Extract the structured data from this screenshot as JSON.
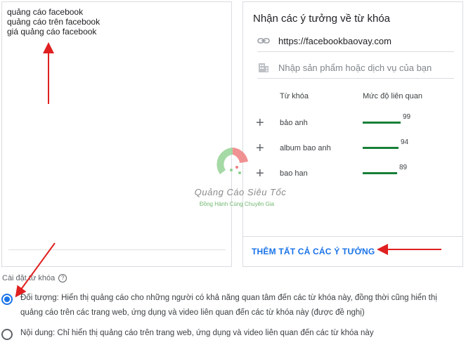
{
  "keywords_box": {
    "text": "quảng cáo facebook\nquảng cáo trên facebook\ngiá quảng cáo facebook"
  },
  "ideas": {
    "title": "Nhận các ý tưởng về từ khóa",
    "url_value": "https://facebookbaovay.com",
    "url_icon": "link-icon",
    "product_placeholder": "Nhập sản phẩm hoặc dịch vụ của bạn",
    "product_icon": "building-icon",
    "col_keyword": "Từ khóa",
    "col_relevance": "Mức độ liên quan",
    "suggestions": [
      {
        "keyword": "bảo anh",
        "relevance": 99,
        "relevance_label": "99"
      },
      {
        "keyword": "album bao anh",
        "relevance": 94,
        "relevance_label": "94"
      },
      {
        "keyword": "bao han",
        "relevance": 89,
        "relevance_label": "89"
      }
    ],
    "add_all_label": "THÊM TẤT CẢ CÁC Ý TƯỞNG",
    "accent_color": "#1a73e8",
    "bar_color": "#188038"
  },
  "settings": {
    "label": "Cài đặt từ khóa",
    "options": [
      {
        "label": "Đối tượng: Hiển thị quảng cáo cho những người có khả năng quan tâm đến các từ khóa này, đồng thời cũng hiển thị quảng cáo trên các trang web, ứng dụng và video liên quan đến các từ khóa này (được đề nghị)",
        "selected": true
      },
      {
        "label": "Nội dung: Chỉ hiển thị quảng cáo trên trang web, ứng dụng và video liên quan đến các từ khóa này",
        "selected": false
      }
    ]
  },
  "watermark": {
    "name": "Quảng Cáo Siêu Tốc",
    "slogan": "Đồng Hành Cùng Chuyên Gia"
  }
}
